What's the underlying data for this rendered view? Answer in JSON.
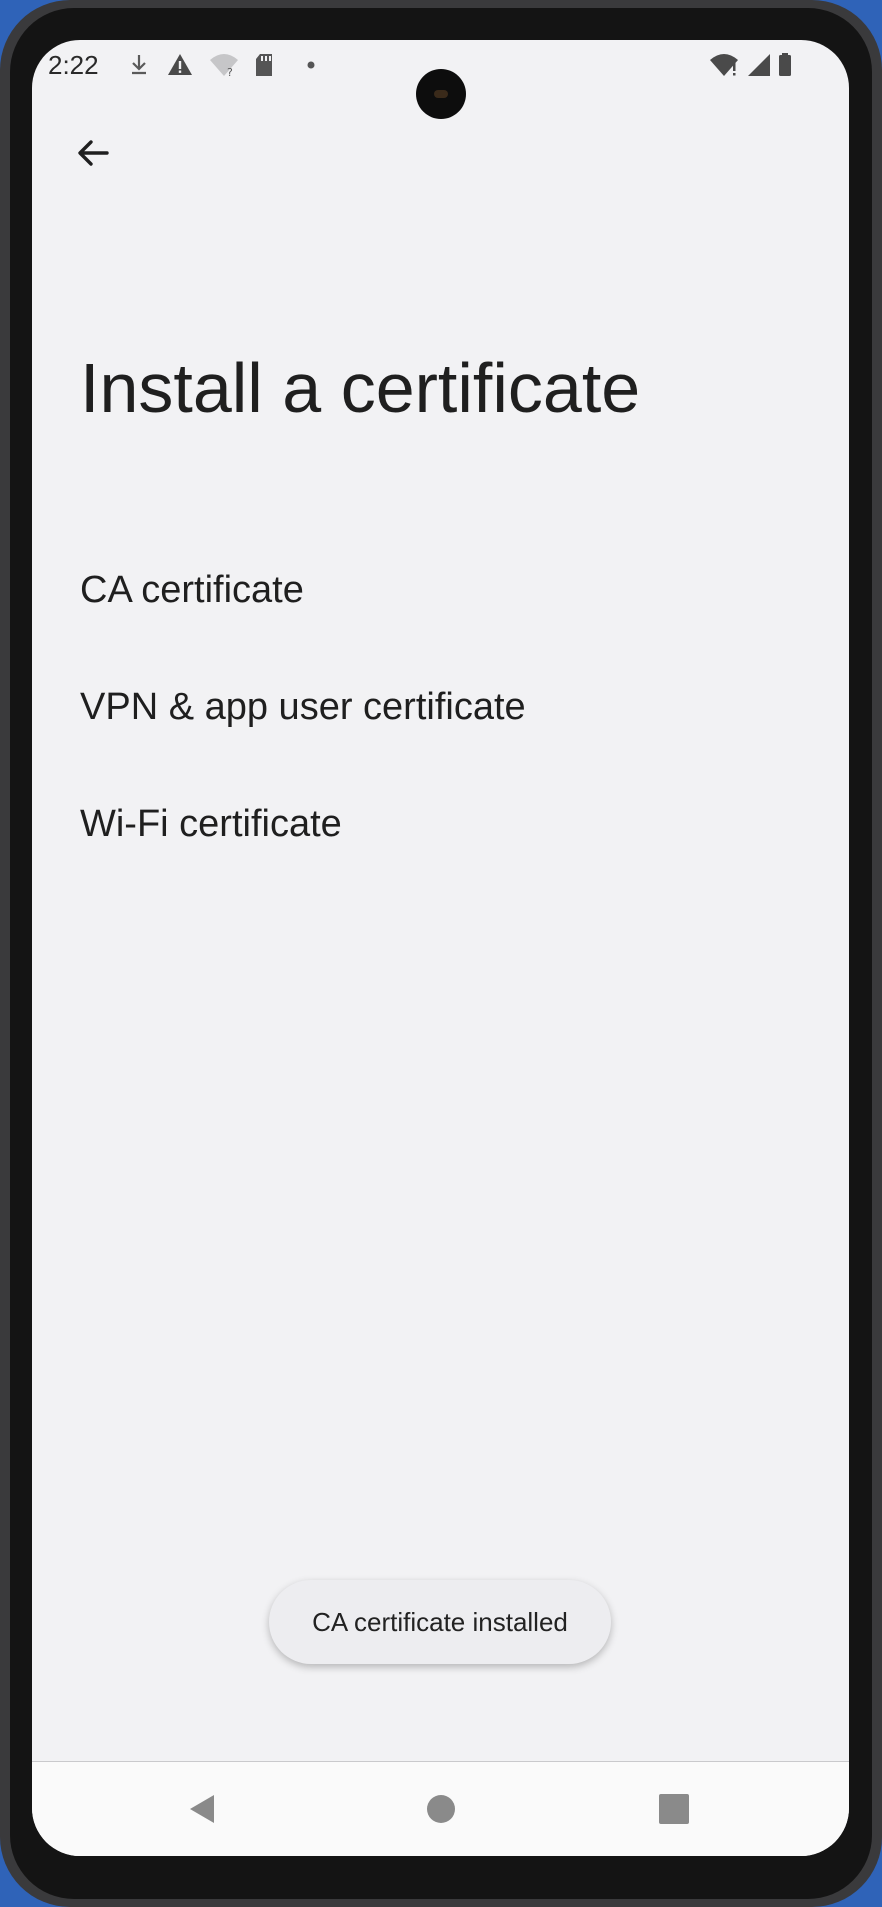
{
  "status_bar": {
    "time": "2:22",
    "left_icons": [
      "download-icon",
      "warning-icon",
      "wifi-unknown-icon",
      "sd-card-icon",
      "dot-icon"
    ],
    "right_icons": [
      "wifi-alert-icon",
      "cellular-signal-icon",
      "battery-icon"
    ]
  },
  "header": {
    "back_icon": "arrow-left-icon",
    "title": "Install a certificate"
  },
  "menu": {
    "items": [
      {
        "label": "CA certificate"
      },
      {
        "label": "VPN & app user certificate"
      },
      {
        "label": "Wi-Fi certificate"
      }
    ]
  },
  "toast": {
    "message": "CA certificate installed"
  },
  "nav_bar": {
    "buttons": [
      "back-triangle-icon",
      "home-circle-icon",
      "recents-square-icon"
    ]
  },
  "colors": {
    "background": "#f2f2f4",
    "text": "#1f1f1f",
    "nav_icon": "#8a8a8a"
  }
}
